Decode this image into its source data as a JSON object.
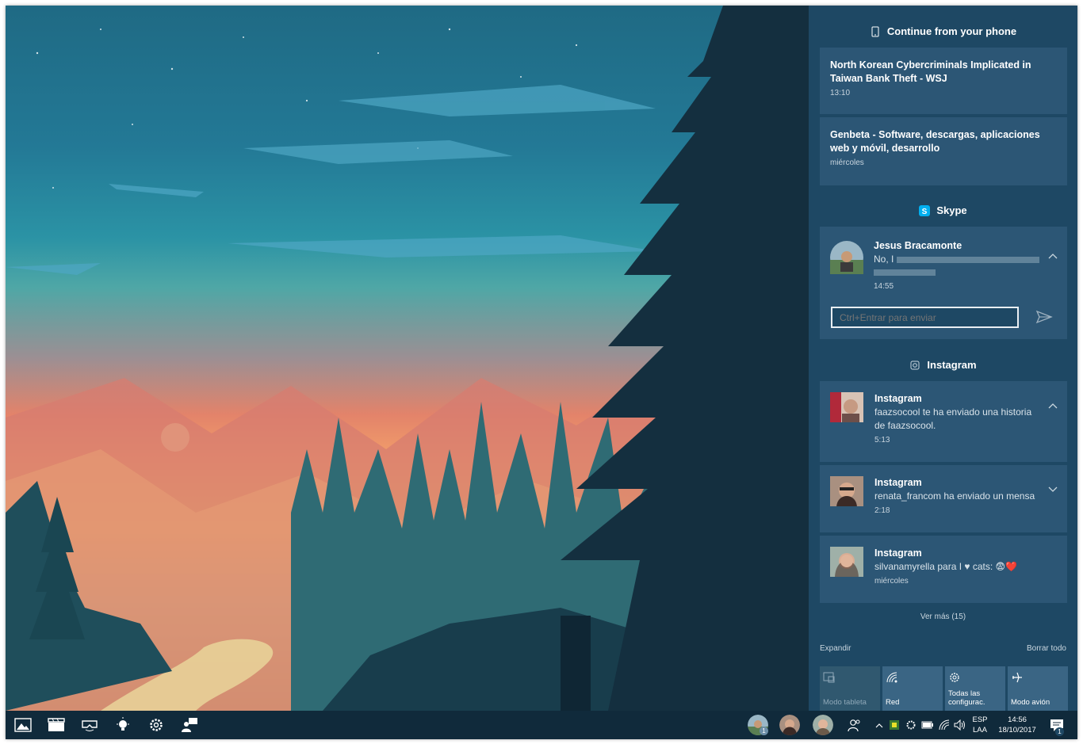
{
  "action_center": {
    "groups": {
      "phone": {
        "header": "Continue from your phone"
      },
      "skype": {
        "header": "Skype"
      },
      "instagram": {
        "header": "Instagram"
      }
    },
    "phone_cards": [
      {
        "title": "North Korean Cybercriminals Implicated in Taiwan Bank Theft - WSJ",
        "time": "13:10"
      },
      {
        "title": "Genbeta - Software, descargas, aplicaciones web y móvil, desarrollo",
        "time": "miércoles"
      }
    ],
    "skype_card": {
      "sender": "Jesus Bracamonte",
      "message_prefix": "No, I",
      "time": "14:55",
      "reply_placeholder": "Ctrl+Entrar para enviar"
    },
    "instagram_cards": [
      {
        "title": "Instagram",
        "body": "faazsocool te ha enviado una historia de faazsocool.",
        "time": "5:13"
      },
      {
        "title": "Instagram",
        "body": "renata_francom ha enviado un mensa",
        "time": "2:18"
      },
      {
        "title": "Instagram",
        "body": "silvanamyrella para I ♥ cats: 😨❤️",
        "time": "miércoles"
      }
    ],
    "see_more": "Ver más (15)",
    "expand": "Expandir",
    "clear_all": "Borrar todo",
    "quick_actions": [
      {
        "label": "Modo tableta",
        "icon": "tablet-mode-icon",
        "enabled": false
      },
      {
        "label": "Red",
        "icon": "network-icon",
        "enabled": true
      },
      {
        "label": "Todas las configurac.",
        "icon": "settings-gear-icon",
        "enabled": true
      },
      {
        "label": "Modo avión",
        "icon": "airplane-icon",
        "enabled": true
      }
    ]
  },
  "taskbar": {
    "pinned": [
      "photos-icon",
      "movies-icon",
      "mixed-reality-icon",
      "tips-icon",
      "settings-icon",
      "people-app-icon"
    ],
    "people_badge": "1",
    "tray": {
      "language_top": "ESP",
      "language_bottom": "LAA",
      "time": "14:56",
      "date": "18/10/2017",
      "notification_count": "1"
    }
  },
  "colors": {
    "action_center_bg": "#1e4864",
    "card_bg": "#2c5675",
    "taskbar_bg": "#102a3b"
  }
}
